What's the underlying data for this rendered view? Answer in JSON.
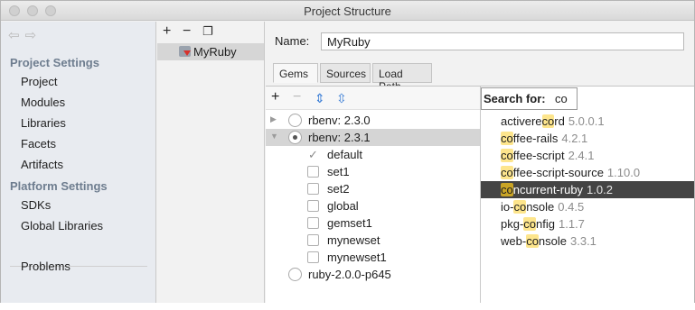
{
  "window": {
    "title": "Project Structure"
  },
  "nav": {
    "sections": [
      {
        "heading": "Project Settings",
        "items": [
          "Project",
          "Modules",
          "Libraries",
          "Facets",
          "Artifacts"
        ]
      },
      {
        "heading": "Platform Settings",
        "items": [
          "SDKs",
          "Global Libraries"
        ]
      }
    ],
    "problems": "Problems"
  },
  "middle": {
    "item": "MyRuby"
  },
  "detail": {
    "name_label": "Name:",
    "name_value": "MyRuby",
    "tabs": [
      "Gems",
      "Sources",
      "Load Path"
    ],
    "active_tab": "Gems"
  },
  "tree": [
    {
      "label": "rbenv: 2.3.0",
      "kind": "sdk",
      "expanded": false,
      "radio_on": false,
      "selected": false
    },
    {
      "label": "rbenv: 2.3.1",
      "kind": "sdk",
      "expanded": true,
      "radio_on": true,
      "selected": true
    },
    {
      "label": "default",
      "kind": "gemset",
      "checked": true
    },
    {
      "label": "set1",
      "kind": "gemset",
      "checked": false
    },
    {
      "label": "set2",
      "kind": "gemset",
      "checked": false
    },
    {
      "label": "global",
      "kind": "gemset",
      "checked": false
    },
    {
      "label": "gemset1",
      "kind": "gemset",
      "checked": false
    },
    {
      "label": "mynewset",
      "kind": "gemset",
      "checked": false
    },
    {
      "label": "mynewset1",
      "kind": "gemset",
      "checked": false
    },
    {
      "label": "ruby-2.0.0-p645",
      "kind": "sdk",
      "radio_on": false,
      "selected": false
    }
  ],
  "search": {
    "label": "Search for:",
    "query": "co",
    "results": [
      {
        "pre": "activere",
        "match": "co",
        "post": "rd",
        "version": "5.0.0.1",
        "selected": false
      },
      {
        "pre": "",
        "match": "co",
        "post": "ffee-rails",
        "version": "4.2.1",
        "selected": false
      },
      {
        "pre": "",
        "match": "co",
        "post": "ffee-script",
        "version": "2.4.1",
        "selected": false
      },
      {
        "pre": "",
        "match": "co",
        "post": "ffee-script-source",
        "version": "1.10.0",
        "selected": false
      },
      {
        "pre": "",
        "match": "co",
        "post": "ncurrent-ruby",
        "version": "1.0.2",
        "selected": true
      },
      {
        "pre": "io-",
        "match": "co",
        "post": "nsole",
        "version": "0.4.5",
        "selected": false
      },
      {
        "pre": "pkg-",
        "match": "co",
        "post": "nfig",
        "version": "1.1.7",
        "selected": false
      },
      {
        "pre": "web-",
        "match": "co",
        "post": "nsole",
        "version": "3.3.1",
        "selected": false
      }
    ]
  },
  "icons": {
    "add": "+",
    "remove": "−",
    "copy": "copy-icon",
    "expand_all": "expand-all-icon",
    "collapse_all": "collapse-all-icon"
  },
  "colors": {
    "highlight": "#fde58c",
    "selected_row": "#444444",
    "nav_heading": "#6e7d8f"
  }
}
